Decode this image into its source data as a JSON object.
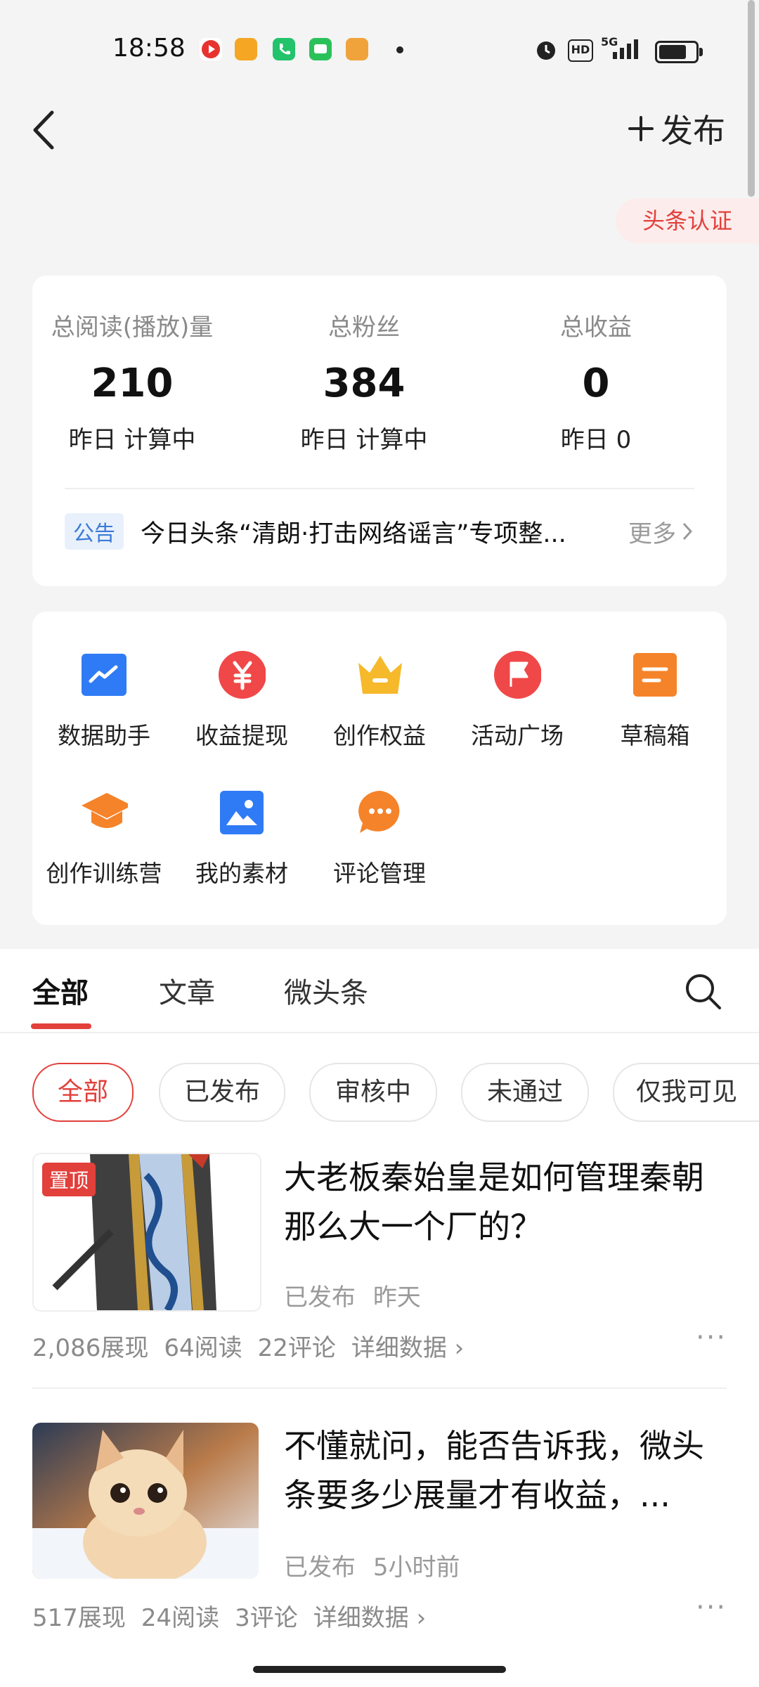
{
  "status_bar": {
    "time": "18:58",
    "network": "5G",
    "hd": "HD"
  },
  "header": {
    "publish_label": "发布",
    "verify_label": "头条认证"
  },
  "stats": [
    {
      "label": "总阅读(播放)量",
      "value": "210",
      "sub": "昨日 计算中"
    },
    {
      "label": "总粉丝",
      "value": "384",
      "sub": "昨日 计算中"
    },
    {
      "label": "总收益",
      "value": "0",
      "sub": "昨日 0"
    }
  ],
  "notice": {
    "tag": "公告",
    "text": "今日头条“清朗·打击网络谣言”专项整...",
    "more": "更多"
  },
  "tools": [
    {
      "label": "数据助手",
      "icon": "chart-icon",
      "color": "#2f7bf5"
    },
    {
      "label": "收益提现",
      "icon": "yen-icon",
      "color": "#f04848"
    },
    {
      "label": "创作权益",
      "icon": "crown-icon",
      "color": "#f6b92b"
    },
    {
      "label": "活动广场",
      "icon": "flag-icon",
      "color": "#f04848"
    },
    {
      "label": "草稿箱",
      "icon": "draft-icon",
      "color": "#f5832a"
    },
    {
      "label": "创作训练营",
      "icon": "graduation-cap-icon",
      "color": "#f5832a"
    },
    {
      "label": "我的素材",
      "icon": "image-icon",
      "color": "#2f7bf5"
    },
    {
      "label": "评论管理",
      "icon": "comment-icon",
      "color": "#f5832a"
    }
  ],
  "tabs": [
    "全部",
    "文章",
    "微头条"
  ],
  "filters": [
    "全部",
    "已发布",
    "审核中",
    "未通过",
    "仅我可见"
  ],
  "posts": [
    {
      "pinned": "置顶",
      "title": "大老板秦始皇是如何管理秦朝那么大一个厂的？",
      "status": "已发布",
      "time": "昨天",
      "impressions": "2,086展现",
      "reads": "64阅读",
      "comments": "22评论",
      "detail": "详细数据"
    },
    {
      "title": "不懂就问，能否告诉我，微头条要多少展量才有收益，...",
      "status": "已发布",
      "time": "5小时前",
      "impressions": "517展现",
      "reads": "24阅读",
      "comments": "3评论",
      "detail": "详细数据"
    }
  ]
}
